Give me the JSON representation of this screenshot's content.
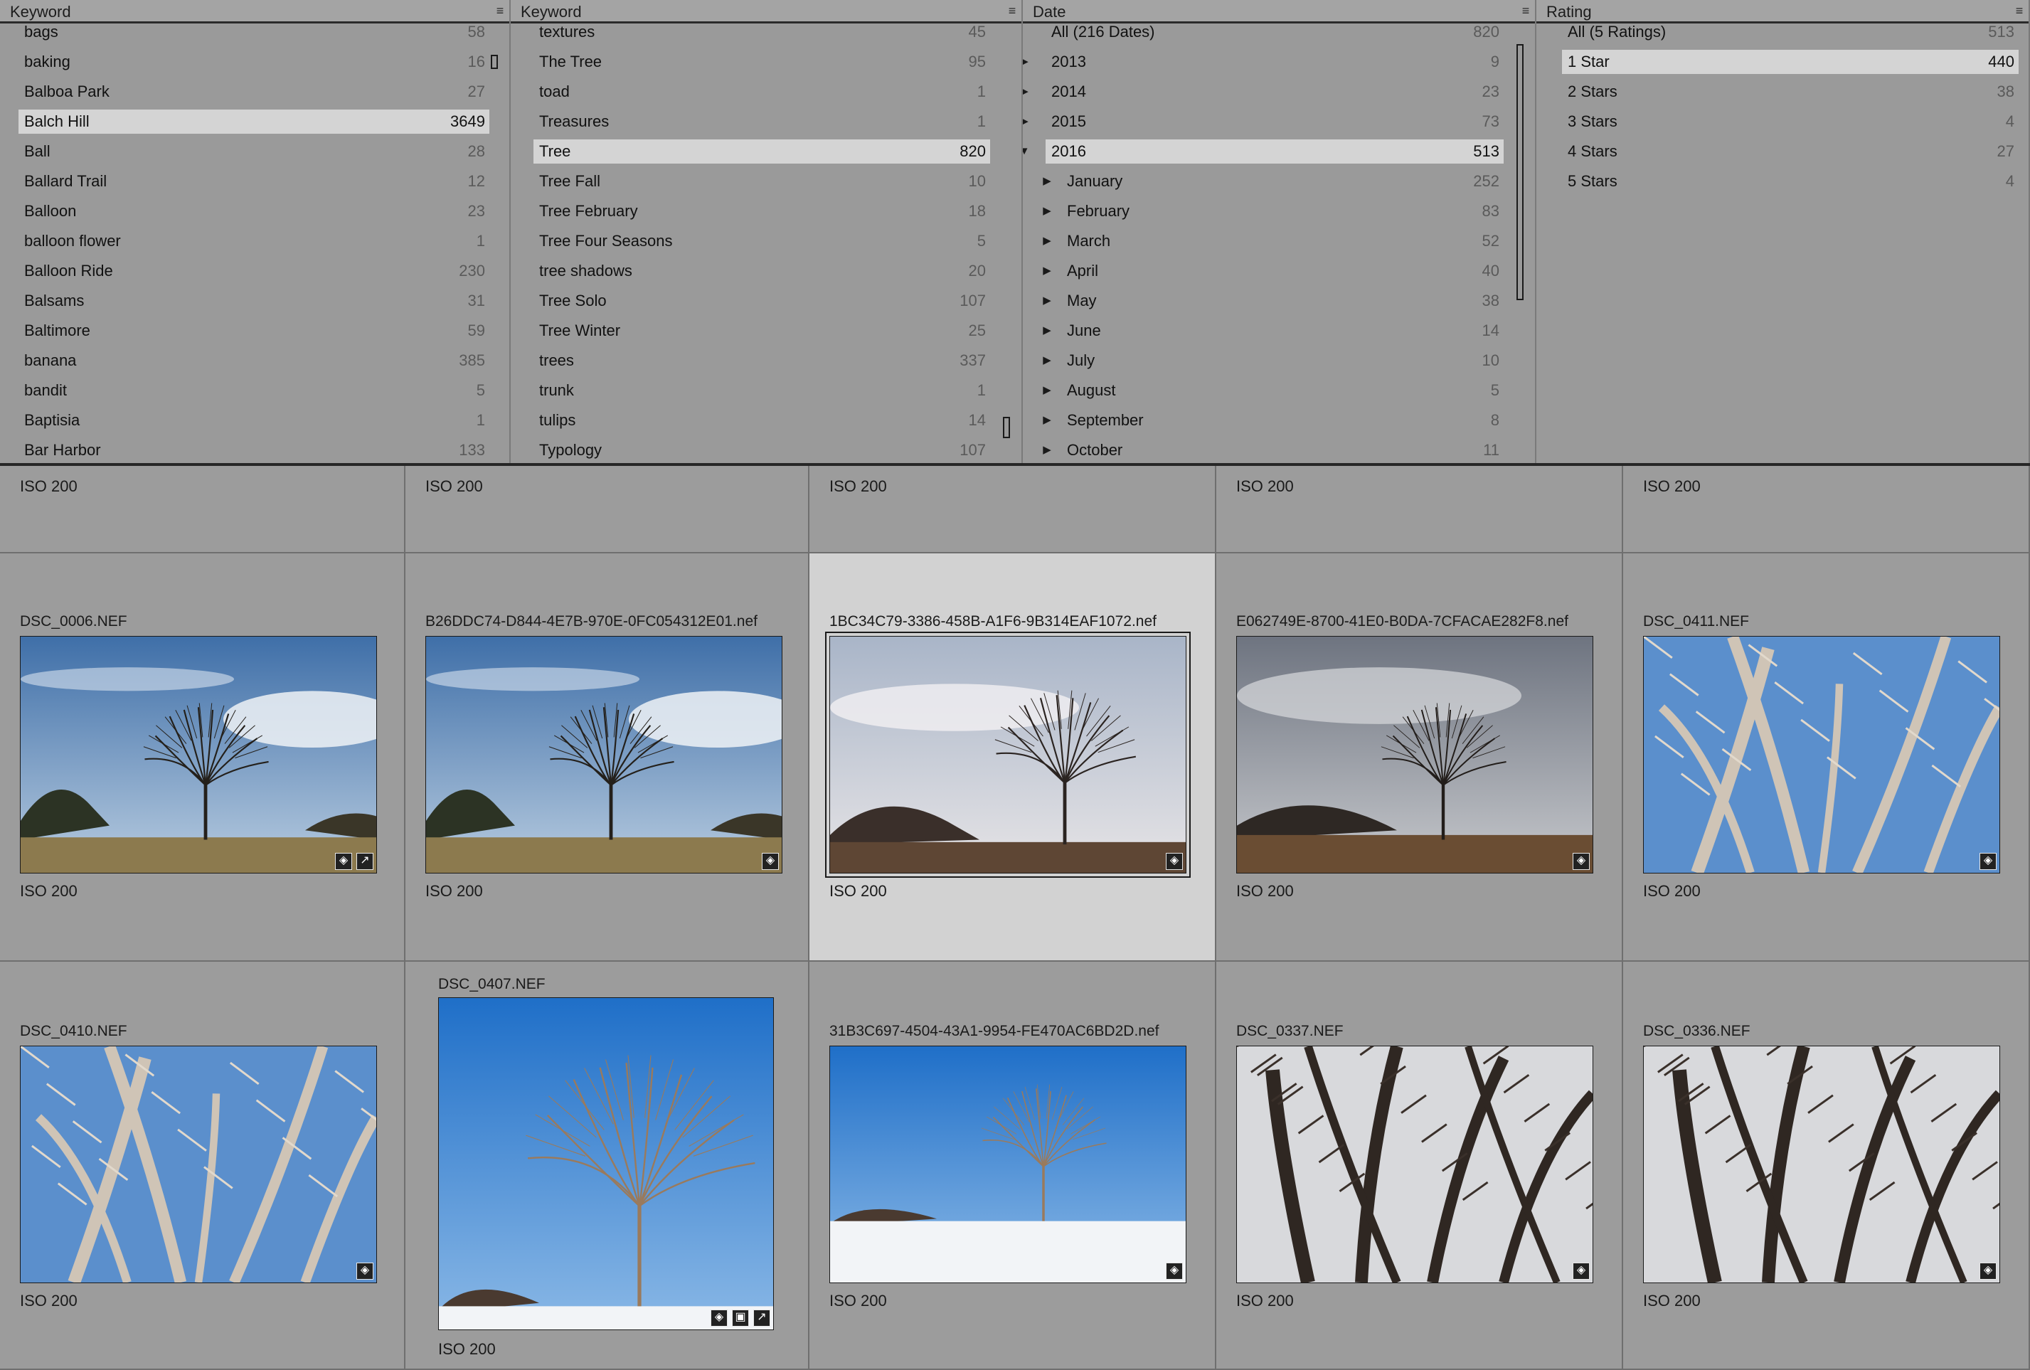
{
  "filter_bar": {
    "columns": [
      {
        "title": "Keyword",
        "rows": [
          {
            "label": "bags",
            "count": "58"
          },
          {
            "label": "baking",
            "count": "16"
          },
          {
            "label": "Balboa Park",
            "count": "27"
          },
          {
            "label": "Balch Hill",
            "count": "3649",
            "selected": true
          },
          {
            "label": "Ball",
            "count": "28"
          },
          {
            "label": "Ballard Trail",
            "count": "12"
          },
          {
            "label": "Balloon",
            "count": "23"
          },
          {
            "label": "balloon flower",
            "count": "1"
          },
          {
            "label": "Balloon Ride",
            "count": "230"
          },
          {
            "label": "Balsams",
            "count": "31"
          },
          {
            "label": "Baltimore",
            "count": "59"
          },
          {
            "label": "banana",
            "count": "385"
          },
          {
            "label": "bandit",
            "count": "5"
          },
          {
            "label": "Baptisia",
            "count": "1"
          },
          {
            "label": "Bar Harbor",
            "count": "133"
          }
        ]
      },
      {
        "title": "Keyword",
        "rows": [
          {
            "label": "textures",
            "count": "45"
          },
          {
            "label": "The Tree",
            "count": "95"
          },
          {
            "label": "toad",
            "count": "1"
          },
          {
            "label": "Treasures",
            "count": "1"
          },
          {
            "label": "Tree",
            "count": "820",
            "selected": true
          },
          {
            "label": "Tree Fall",
            "count": "10"
          },
          {
            "label": "Tree February",
            "count": "18"
          },
          {
            "label": "Tree Four Seasons",
            "count": "5"
          },
          {
            "label": "tree shadows",
            "count": "20"
          },
          {
            "label": "Tree Solo",
            "count": "107"
          },
          {
            "label": "Tree Winter",
            "count": "25"
          },
          {
            "label": "trees",
            "count": "337"
          },
          {
            "label": "trunk",
            "count": "1"
          },
          {
            "label": "tulips",
            "count": "14"
          },
          {
            "label": "Typology",
            "count": "107"
          }
        ]
      },
      {
        "title": "Date",
        "rows": [
          {
            "label": "All (216 Dates)",
            "count": "820",
            "level": 0
          },
          {
            "label": "2013",
            "count": "9",
            "level": 1,
            "disclosure": "collapsed"
          },
          {
            "label": "2014",
            "count": "23",
            "level": 1,
            "disclosure": "collapsed"
          },
          {
            "label": "2015",
            "count": "73",
            "level": 1,
            "disclosure": "collapsed"
          },
          {
            "label": "2016",
            "count": "513",
            "level": 1,
            "disclosure": "expanded",
            "selected": true
          },
          {
            "label": "January",
            "count": "252",
            "level": 2,
            "disclosure": "collapsed"
          },
          {
            "label": "February",
            "count": "83",
            "level": 2,
            "disclosure": "collapsed"
          },
          {
            "label": "March",
            "count": "52",
            "level": 2,
            "disclosure": "collapsed"
          },
          {
            "label": "April",
            "count": "40",
            "level": 2,
            "disclosure": "collapsed"
          },
          {
            "label": "May",
            "count": "38",
            "level": 2,
            "disclosure": "collapsed"
          },
          {
            "label": "June",
            "count": "14",
            "level": 2,
            "disclosure": "collapsed"
          },
          {
            "label": "July",
            "count": "10",
            "level": 2,
            "disclosure": "collapsed"
          },
          {
            "label": "August",
            "count": "5",
            "level": 2,
            "disclosure": "collapsed"
          },
          {
            "label": "September",
            "count": "8",
            "level": 2,
            "disclosure": "collapsed"
          },
          {
            "label": "October",
            "count": "11",
            "level": 2,
            "disclosure": "collapsed"
          }
        ]
      },
      {
        "title": "Rating",
        "rows": [
          {
            "label": "All (5 Ratings)",
            "count": "513"
          },
          {
            "label": "1 Star",
            "count": "440",
            "selected": true
          },
          {
            "label": "2 Stars",
            "count": "38"
          },
          {
            "label": "3 Stars",
            "count": "4"
          },
          {
            "label": "4 Stars",
            "count": "27"
          },
          {
            "label": "5 Stars",
            "count": "4"
          }
        ]
      }
    ]
  },
  "grid": {
    "top_row_iso": [
      "ISO 200",
      "ISO 200",
      "ISO 200",
      "ISO 200",
      "ISO 200"
    ],
    "photos": [
      {
        "filename": "DSC_0006.NEF",
        "iso": "ISO 200",
        "scene": "tree-field-blue",
        "badges": [
          "keyword-badge-icon",
          "develop-badge-icon"
        ]
      },
      {
        "filename": "B26DDC74-D844-4E7B-970E-0FC054312E01.nef",
        "iso": "ISO 200",
        "scene": "tree-field-blue",
        "badges": [
          "keyword-badge-icon"
        ]
      },
      {
        "filename": "1BC34C79-3386-458B-A1F6-9B314EAF1072.nef",
        "iso": "ISO 200",
        "scene": "tree-field-cloudy",
        "badges": [
          "keyword-badge-icon"
        ],
        "selected": true
      },
      {
        "filename": "E062749E-8700-41E0-B0DA-7CFACAE282F8.nef",
        "iso": "ISO 200",
        "scene": "tree-field-grey",
        "badges": [
          "keyword-badge-icon"
        ]
      },
      {
        "filename": "DSC_0411.NEF",
        "iso": "ISO 200",
        "scene": "branches-blue",
        "badges": [
          "keyword-badge-icon"
        ]
      },
      {
        "filename": "DSC_0410.NEF",
        "iso": "ISO 200",
        "scene": "branches-blue",
        "badges": [
          "keyword-badge-icon"
        ]
      },
      {
        "filename": "DSC_0407.NEF",
        "iso": "ISO 200",
        "scene": "tree-snow-portrait",
        "badges": [
          "keyword-badge-icon",
          "crop-badge-icon",
          "develop-badge-icon"
        ]
      },
      {
        "filename": "31B3C697-4504-43A1-9954-FE470AC6BD2D.nef",
        "iso": "ISO 200",
        "scene": "tree-snow",
        "badges": [
          "keyword-badge-icon"
        ]
      },
      {
        "filename": "DSC_0337.NEF",
        "iso": "ISO 200",
        "scene": "branches-dark",
        "badges": [
          "keyword-badge-icon"
        ]
      },
      {
        "filename": "DSC_0336.NEF",
        "iso": "ISO 200",
        "scene": "branches-dark",
        "badges": [
          "keyword-badge-icon"
        ]
      }
    ]
  },
  "colors": {
    "panel_bg": "#9a9a9a",
    "selected_row": "#d4d4d4",
    "cell_bg": "#9c9c9c",
    "selected_cell": "#d2d2d2"
  }
}
